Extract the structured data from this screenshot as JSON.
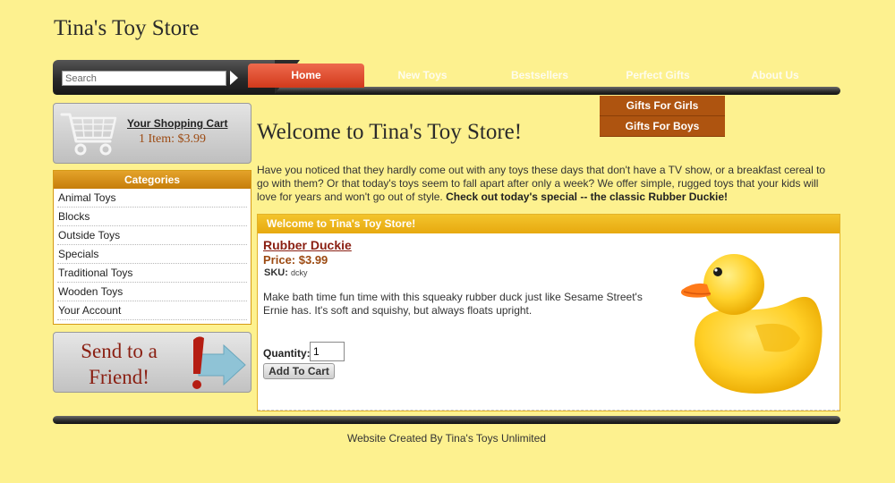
{
  "site": {
    "title": "Tina's Toy Store"
  },
  "search": {
    "placeholder": "Search"
  },
  "nav": {
    "tabs": [
      {
        "label": "Home",
        "active": true
      },
      {
        "label": "New Toys",
        "active": false
      },
      {
        "label": "Bestsellers",
        "active": false
      },
      {
        "label": "Perfect Gifts",
        "active": false
      },
      {
        "label": "About Us",
        "active": false
      }
    ],
    "dropdown": [
      "Gifts For Girls",
      "Gifts For Boys"
    ]
  },
  "cart": {
    "link": "Your Shopping Cart",
    "count": "1 Item: $3.99",
    "icon": "shopping-cart-icon"
  },
  "categories": {
    "header": "Categories",
    "items": [
      "Animal Toys",
      "Blocks",
      "Outside Toys",
      "Specials",
      "Traditional Toys",
      "Wooden Toys",
      "Your Account"
    ]
  },
  "send_friend": {
    "line1": "Send to a",
    "line2": "Friend!",
    "icon": "exclamation-arrow-icon"
  },
  "main": {
    "title": "Welcome to Tina's Toy Store!",
    "intro": "Have you noticed that they hardly come out with any toys these days that don't have a TV show, or a breakfast cereal to go with them? Or that today's toys seem to fall apart after only a week? We offer simple, rugged toys that your kids will love for years and won't go out of style.",
    "intro_bold": "Check out today's special -- the classic Rubber Duckie!"
  },
  "feature": {
    "header": "Welcome to Tina's Toy Store!",
    "product_name": "Rubber Duckie",
    "price": "Price: $3.99",
    "sku_label": "SKU:",
    "sku_value": "dcky",
    "description": "Make bath time fun time with this squeaky rubber duck just like Sesame Street's Ernie has. It's soft and squishy, but always floats upright.",
    "quantity_label": "Quantity:",
    "quantity_value": "1",
    "add_button": "Add To Cart",
    "image_icon": "rubber-duck-image"
  },
  "footer": {
    "text": "Website Created By Tina's Toys Unlimited"
  },
  "colors": {
    "background": "#fdf18f",
    "accent_red": "#d23a1c",
    "accent_orange": "#ae5410",
    "accent_gold": "#e7a90f",
    "link_dark_red": "#8a1f12"
  }
}
